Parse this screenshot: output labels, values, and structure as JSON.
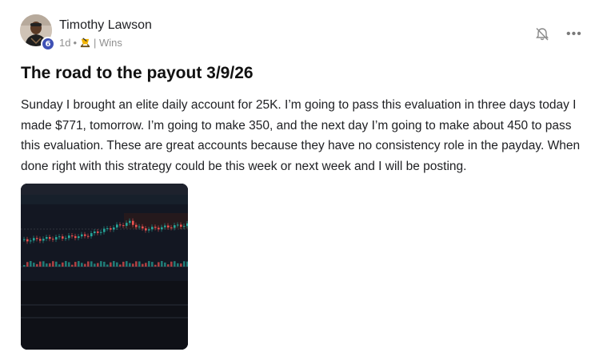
{
  "author": {
    "name": "Timothy Lawson",
    "level": "6"
  },
  "meta": {
    "time": "1d",
    "dot": "•",
    "category": "| Wins",
    "category_icon": "trophy-icon"
  },
  "post": {
    "title": "The road to the payout 3/9/26",
    "body": "Sunday I brought an elite daily account for 25K. I’m going to pass this evaluation in three days today I made $771, tomorrow. I’m going to make 350, and the next day I’m going to make about 450 to pass this evaluation. These are great accounts because they have no consistency role in the payday. When done right with this strategy could be this week or next week and I will be posting."
  },
  "actions": {
    "notification_icon": "bell-icon",
    "more_label": "•••"
  },
  "attachment": {
    "kind": "trading-chart-screenshot",
    "colors": {
      "background": "#131722",
      "up": "#26a69a",
      "down": "#ef5350"
    }
  }
}
